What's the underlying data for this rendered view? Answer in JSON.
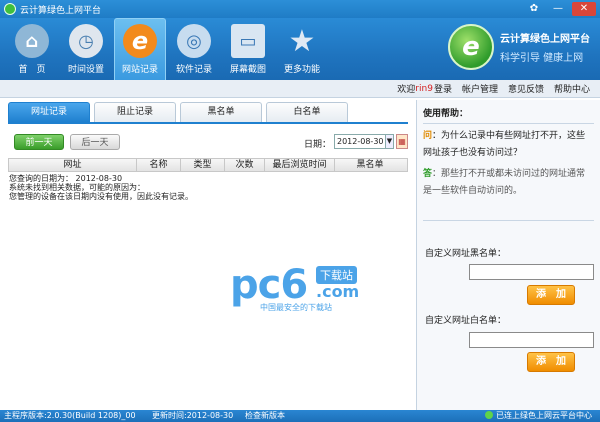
{
  "window": {
    "title": "云计算绿色上网平台",
    "controls": {
      "skin": "✿",
      "minimize": "—",
      "close": "✕"
    }
  },
  "toolbar": {
    "items": [
      {
        "label": "首　页",
        "icon": "home-icon",
        "glyph": "⌂",
        "color": "#8fb7d6"
      },
      {
        "label": "时间设置",
        "icon": "clock-icon",
        "glyph": "◷",
        "color": "#dfe6ee"
      },
      {
        "label": "网站记录",
        "icon": "ie-icon",
        "glyph": "e",
        "color": "#f28a1c"
      },
      {
        "label": "软件记录",
        "icon": "disc-icon",
        "glyph": "◎",
        "color": "#c7dcef"
      },
      {
        "label": "屏幕截图",
        "icon": "monitor-icon",
        "glyph": "▭",
        "color": "#d9e6f2"
      },
      {
        "label": "更多功能",
        "icon": "star-icon",
        "glyph": "★",
        "color": "#cfdceb"
      }
    ]
  },
  "brand": {
    "logo_letter": "e",
    "name": "云计算绿色上网平台",
    "slogan": "科学引导 健康上网"
  },
  "userbar": {
    "welcome": "欢迎",
    "username": "rin9",
    "login": "登录",
    "account": "帐户管理",
    "feedback": "意见反馈",
    "help": "帮助中心"
  },
  "tabs": [
    "网址记录",
    "阻止记录",
    "黑名单",
    "白名单"
  ],
  "filter": {
    "prev": "前一天",
    "next": "后一天",
    "date_label": "日期：",
    "date_value": "2012-08-30"
  },
  "table": {
    "columns": [
      "网址",
      "名称",
      "类型",
      "次数",
      "最后浏览时间",
      "黑名单"
    ]
  },
  "results": {
    "line1": "您查询的日期为： 2012-08-30",
    "line2": "系统未找到相关数据，可能的原因为：",
    "line3": "您管理的设备在该日期内没有使用，因此没有记录。"
  },
  "watermark": {
    "brand": "pc6",
    "badge": "下载站",
    "domain": ".com",
    "tagline": "中国最安全的下载站"
  },
  "help_panel": {
    "title": "使用帮助：",
    "q_mark": "问",
    "question": "：为什么记录中有些网址打不开，这些网址孩子也没有访问过？",
    "a_mark": "答",
    "answer": "：那些打不开或都未访问过的网址通常是一些软件自动访问的。"
  },
  "blacklist": {
    "label": "自定义网址黑名单：",
    "value": "",
    "add": "添　加"
  },
  "whitelist": {
    "label": "自定义网址白名单：",
    "value": "",
    "add": "添　加"
  },
  "statusbar": {
    "version": "主程序版本:2.0.30(Build 1208)_00",
    "update": "更新时间:2012-08-30",
    "check": "检查新版本",
    "connection": "已连上绿色上网云平台中心"
  }
}
